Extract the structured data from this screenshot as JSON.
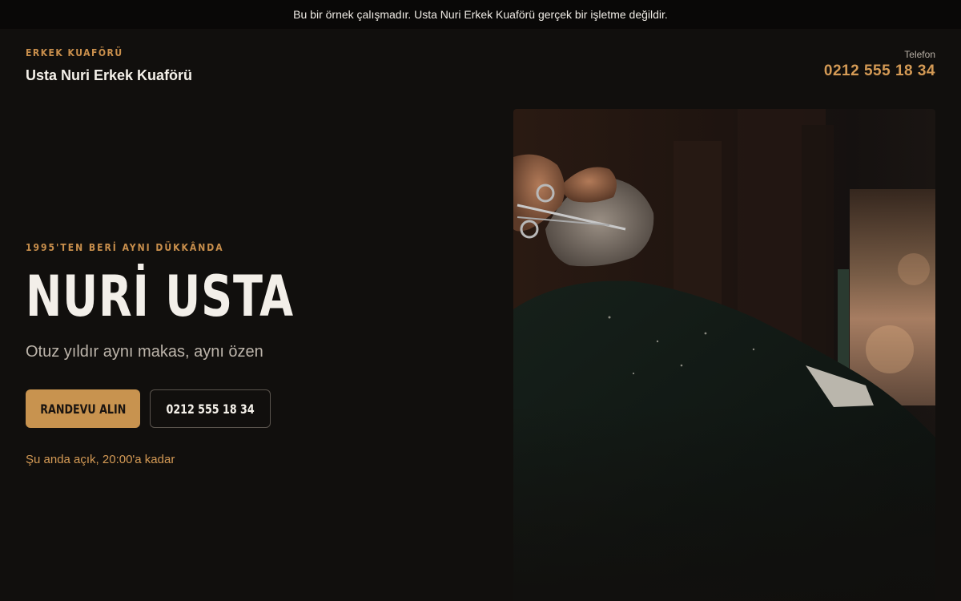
{
  "notice": "Bu bir örnek çalışmadır. Usta Nuri Erkek Kuaförü gerçek bir işletme değildir.",
  "header": {
    "eyebrow": "ERKEK KUAFÖRÜ",
    "brand_name": "Usta Nuri Erkek Kuaförü",
    "phone_label": "Telefon",
    "phone_number": "0212 555 18 34"
  },
  "hero": {
    "tagline": "1995'TEN BERİ AYNI DÜKKÂNDA",
    "title": "NURİ USTA",
    "subtitle": "Otuz yıldır aynı makas, aynı özen",
    "primary_button": "RANDEVU ALIN",
    "secondary_button": "0212 555 18 34",
    "status": "Şu anda açık, 20:00'a kadar"
  },
  "colors": {
    "background": "#110f0d",
    "accent": "#c8934f",
    "notice_bar": "#090807"
  }
}
